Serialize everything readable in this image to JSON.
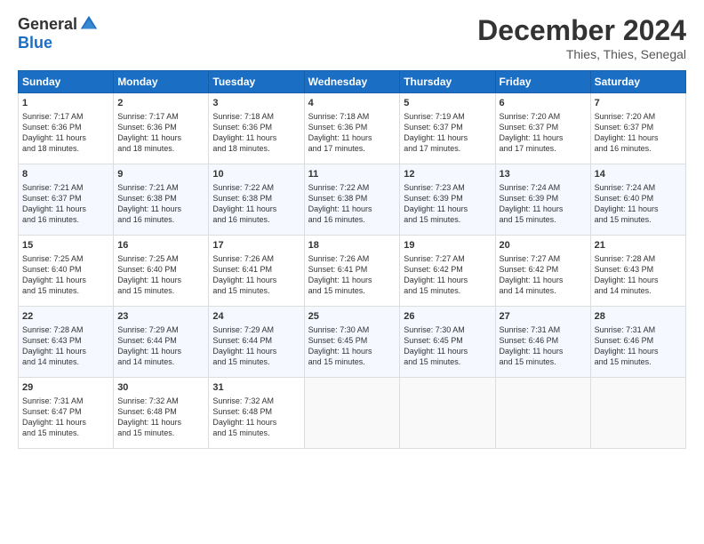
{
  "logo": {
    "general": "General",
    "blue": "Blue"
  },
  "header": {
    "title": "December 2024",
    "subtitle": "Thies, Thies, Senegal"
  },
  "days_of_week": [
    "Sunday",
    "Monday",
    "Tuesday",
    "Wednesday",
    "Thursday",
    "Friday",
    "Saturday"
  ],
  "weeks": [
    [
      {
        "day": "1",
        "info": "Sunrise: 7:17 AM\nSunset: 6:36 PM\nDaylight: 11 hours\nand 18 minutes."
      },
      {
        "day": "2",
        "info": "Sunrise: 7:17 AM\nSunset: 6:36 PM\nDaylight: 11 hours\nand 18 minutes."
      },
      {
        "day": "3",
        "info": "Sunrise: 7:18 AM\nSunset: 6:36 PM\nDaylight: 11 hours\nand 18 minutes."
      },
      {
        "day": "4",
        "info": "Sunrise: 7:18 AM\nSunset: 6:36 PM\nDaylight: 11 hours\nand 17 minutes."
      },
      {
        "day": "5",
        "info": "Sunrise: 7:19 AM\nSunset: 6:37 PM\nDaylight: 11 hours\nand 17 minutes."
      },
      {
        "day": "6",
        "info": "Sunrise: 7:20 AM\nSunset: 6:37 PM\nDaylight: 11 hours\nand 17 minutes."
      },
      {
        "day": "7",
        "info": "Sunrise: 7:20 AM\nSunset: 6:37 PM\nDaylight: 11 hours\nand 16 minutes."
      }
    ],
    [
      {
        "day": "8",
        "info": "Sunrise: 7:21 AM\nSunset: 6:37 PM\nDaylight: 11 hours\nand 16 minutes."
      },
      {
        "day": "9",
        "info": "Sunrise: 7:21 AM\nSunset: 6:38 PM\nDaylight: 11 hours\nand 16 minutes."
      },
      {
        "day": "10",
        "info": "Sunrise: 7:22 AM\nSunset: 6:38 PM\nDaylight: 11 hours\nand 16 minutes."
      },
      {
        "day": "11",
        "info": "Sunrise: 7:22 AM\nSunset: 6:38 PM\nDaylight: 11 hours\nand 16 minutes."
      },
      {
        "day": "12",
        "info": "Sunrise: 7:23 AM\nSunset: 6:39 PM\nDaylight: 11 hours\nand 15 minutes."
      },
      {
        "day": "13",
        "info": "Sunrise: 7:24 AM\nSunset: 6:39 PM\nDaylight: 11 hours\nand 15 minutes."
      },
      {
        "day": "14",
        "info": "Sunrise: 7:24 AM\nSunset: 6:40 PM\nDaylight: 11 hours\nand 15 minutes."
      }
    ],
    [
      {
        "day": "15",
        "info": "Sunrise: 7:25 AM\nSunset: 6:40 PM\nDaylight: 11 hours\nand 15 minutes."
      },
      {
        "day": "16",
        "info": "Sunrise: 7:25 AM\nSunset: 6:40 PM\nDaylight: 11 hours\nand 15 minutes."
      },
      {
        "day": "17",
        "info": "Sunrise: 7:26 AM\nSunset: 6:41 PM\nDaylight: 11 hours\nand 15 minutes."
      },
      {
        "day": "18",
        "info": "Sunrise: 7:26 AM\nSunset: 6:41 PM\nDaylight: 11 hours\nand 15 minutes."
      },
      {
        "day": "19",
        "info": "Sunrise: 7:27 AM\nSunset: 6:42 PM\nDaylight: 11 hours\nand 15 minutes."
      },
      {
        "day": "20",
        "info": "Sunrise: 7:27 AM\nSunset: 6:42 PM\nDaylight: 11 hours\nand 14 minutes."
      },
      {
        "day": "21",
        "info": "Sunrise: 7:28 AM\nSunset: 6:43 PM\nDaylight: 11 hours\nand 14 minutes."
      }
    ],
    [
      {
        "day": "22",
        "info": "Sunrise: 7:28 AM\nSunset: 6:43 PM\nDaylight: 11 hours\nand 14 minutes."
      },
      {
        "day": "23",
        "info": "Sunrise: 7:29 AM\nSunset: 6:44 PM\nDaylight: 11 hours\nand 14 minutes."
      },
      {
        "day": "24",
        "info": "Sunrise: 7:29 AM\nSunset: 6:44 PM\nDaylight: 11 hours\nand 15 minutes."
      },
      {
        "day": "25",
        "info": "Sunrise: 7:30 AM\nSunset: 6:45 PM\nDaylight: 11 hours\nand 15 minutes."
      },
      {
        "day": "26",
        "info": "Sunrise: 7:30 AM\nSunset: 6:45 PM\nDaylight: 11 hours\nand 15 minutes."
      },
      {
        "day": "27",
        "info": "Sunrise: 7:31 AM\nSunset: 6:46 PM\nDaylight: 11 hours\nand 15 minutes."
      },
      {
        "day": "28",
        "info": "Sunrise: 7:31 AM\nSunset: 6:46 PM\nDaylight: 11 hours\nand 15 minutes."
      }
    ],
    [
      {
        "day": "29",
        "info": "Sunrise: 7:31 AM\nSunset: 6:47 PM\nDaylight: 11 hours\nand 15 minutes."
      },
      {
        "day": "30",
        "info": "Sunrise: 7:32 AM\nSunset: 6:48 PM\nDaylight: 11 hours\nand 15 minutes."
      },
      {
        "day": "31",
        "info": "Sunrise: 7:32 AM\nSunset: 6:48 PM\nDaylight: 11 hours\nand 15 minutes."
      },
      {
        "day": "",
        "info": ""
      },
      {
        "day": "",
        "info": ""
      },
      {
        "day": "",
        "info": ""
      },
      {
        "day": "",
        "info": ""
      }
    ]
  ]
}
